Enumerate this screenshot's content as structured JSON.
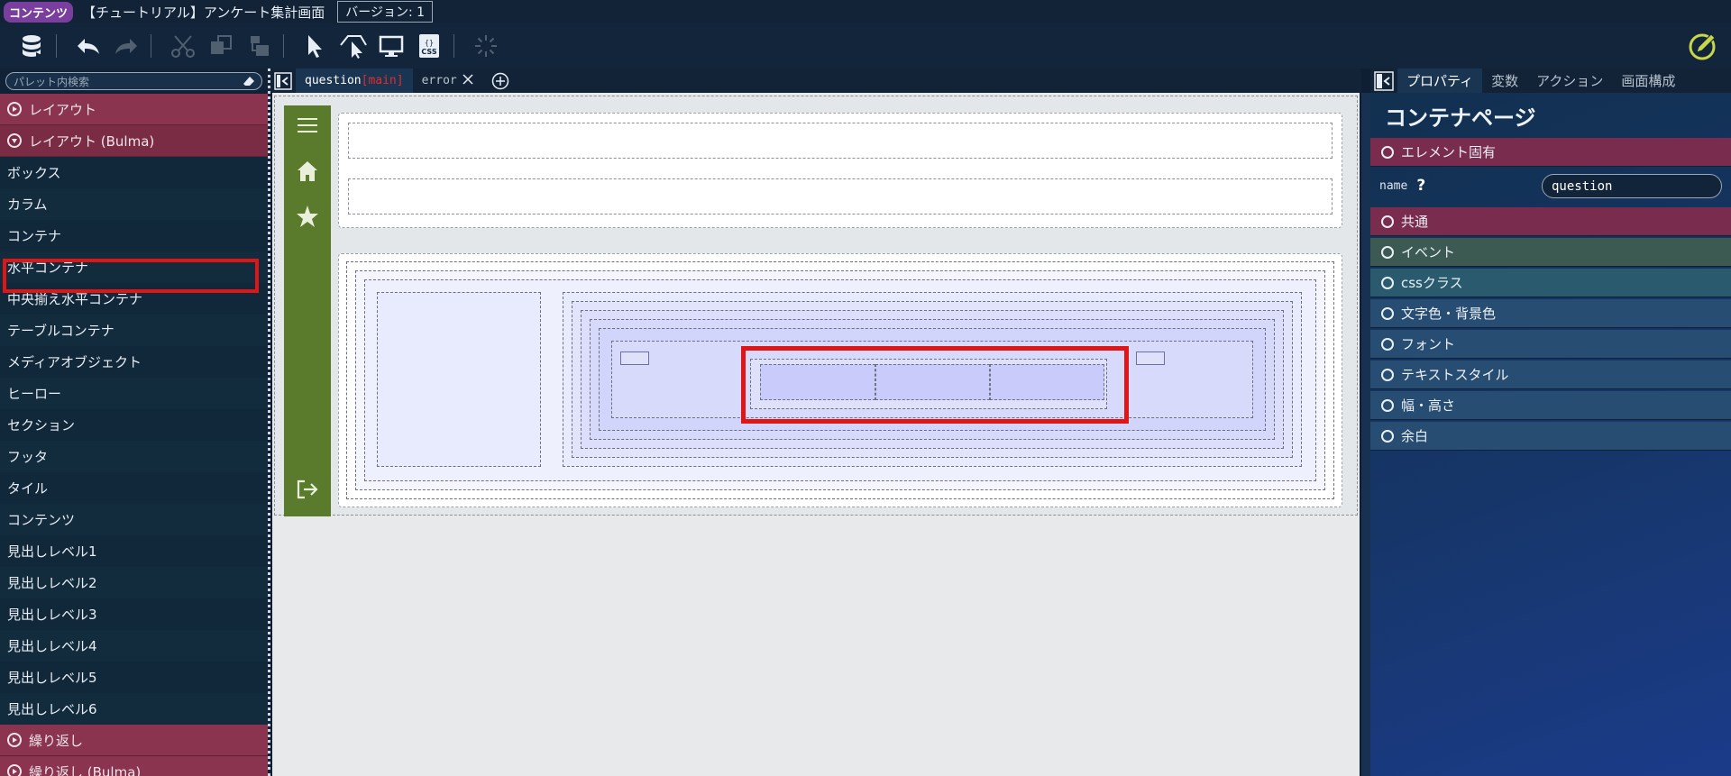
{
  "titlebar": {
    "badge": "コンテンツ",
    "title": "【チュートリアル】アンケート集計画面",
    "version": "バージョン: 1"
  },
  "toolbar": {
    "items": [
      "database-icon",
      "undo-icon",
      "redo-icon",
      "cut-icon",
      "copy-icon",
      "paste-icon",
      "select-icon",
      "select-parent-icon",
      "preview-icon",
      "css-icon",
      "loading-icon",
      "edit-icon"
    ]
  },
  "palette": {
    "search_placeholder": "パレット内検索",
    "sections": [
      {
        "label": "レイアウト",
        "open": false
      },
      {
        "label": "レイアウト (Bulma)",
        "open": true
      }
    ],
    "items": [
      "ボックス",
      "カラム",
      "コンテナ",
      "水平コンテナ",
      "中央揃え水平コンテナ",
      "テーブルコンテナ",
      "メディアオブジェクト",
      "ヒーロー",
      "セクション",
      "フッタ",
      "タイル",
      "コンテンツ",
      "見出しレベル1",
      "見出しレベル2",
      "見出しレベル3",
      "見出しレベル4",
      "見出しレベル5",
      "見出しレベル6"
    ],
    "bottom_sections": [
      {
        "label": "繰り返し"
      },
      {
        "label": "繰り返し (Bulma)"
      }
    ],
    "highlighted_item": "カラム"
  },
  "tabs": [
    {
      "name": "question",
      "context": "[main]",
      "active": true
    },
    {
      "name": "error",
      "context": "",
      "active": false
    }
  ],
  "properties": {
    "tabs": [
      "プロパティ",
      "変数",
      "アクション",
      "画面構成"
    ],
    "active_tab": "プロパティ",
    "title": "コンテナページ",
    "element_section": "エレメント固有",
    "name_label": "name",
    "name_help": "?",
    "name_value": "question",
    "sections": [
      {
        "label": "共通",
        "color": "#7a2c4e"
      },
      {
        "label": "イベント",
        "color": "#3c5a52"
      },
      {
        "label": "cssクラス",
        "color": "#2a5a6e"
      },
      {
        "label": "文字色・背景色",
        "color": "#284d72"
      },
      {
        "label": "フォント",
        "color": "#284d72"
      },
      {
        "label": "テキストスタイル",
        "color": "#284d72"
      },
      {
        "label": "幅・高さ",
        "color": "#284d72"
      },
      {
        "label": "余白",
        "color": "#284d72"
      }
    ]
  }
}
